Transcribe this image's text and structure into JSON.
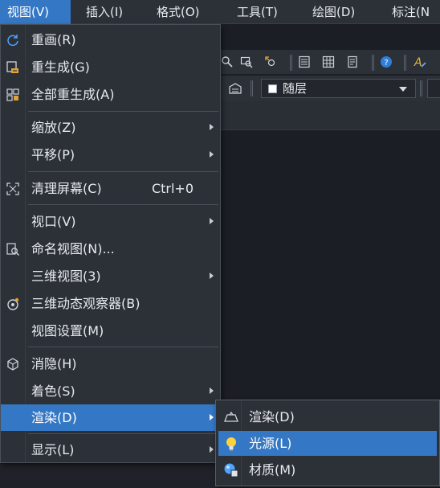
{
  "menubar": {
    "items": [
      {
        "label": "视图(V)"
      },
      {
        "label": "插入(I)"
      },
      {
        "label": "格式(O)"
      },
      {
        "label": "工具(T)"
      },
      {
        "label": "绘图(D)"
      },
      {
        "label": "标注(N"
      }
    ]
  },
  "toolbar": {
    "layer_combo": "随层"
  },
  "view_menu": {
    "items": [
      {
        "label": "重画(R)",
        "icon": "redraw-icon"
      },
      {
        "label": "重生成(G)",
        "icon": "regen-icon"
      },
      {
        "label": "全部重生成(A)",
        "icon": "regen-all-icon"
      },
      {
        "label": "缩放(Z)",
        "submenu": true
      },
      {
        "label": "平移(P)",
        "submenu": true
      },
      {
        "label": "清理屏幕(C)",
        "shortcut": "Ctrl+0",
        "icon": "clean-screen-icon"
      },
      {
        "label": "视口(V)",
        "submenu": true
      },
      {
        "label": "命名视图(N)...",
        "icon": "named-view-icon"
      },
      {
        "label": "三维视图(3)",
        "submenu": true
      },
      {
        "label": "三维动态观察器(B)",
        "icon": "orbit-icon"
      },
      {
        "label": "视图设置(M)"
      },
      {
        "label": "消隐(H)",
        "icon": "hide-icon"
      },
      {
        "label": "着色(S)",
        "submenu": true
      },
      {
        "label": "渲染(D)",
        "submenu": true
      },
      {
        "label": "显示(L)",
        "submenu": true
      }
    ]
  },
  "render_submenu": {
    "items": [
      {
        "label": "渲染(D)",
        "icon": "render-icon"
      },
      {
        "label": "光源(L)",
        "icon": "light-bulb-icon"
      },
      {
        "label": "材质(M)",
        "icon": "material-icon"
      }
    ]
  },
  "colors": {
    "menu_bg": "#2c3037",
    "highlight": "#3477c4",
    "canvas": "#1b1e24"
  }
}
